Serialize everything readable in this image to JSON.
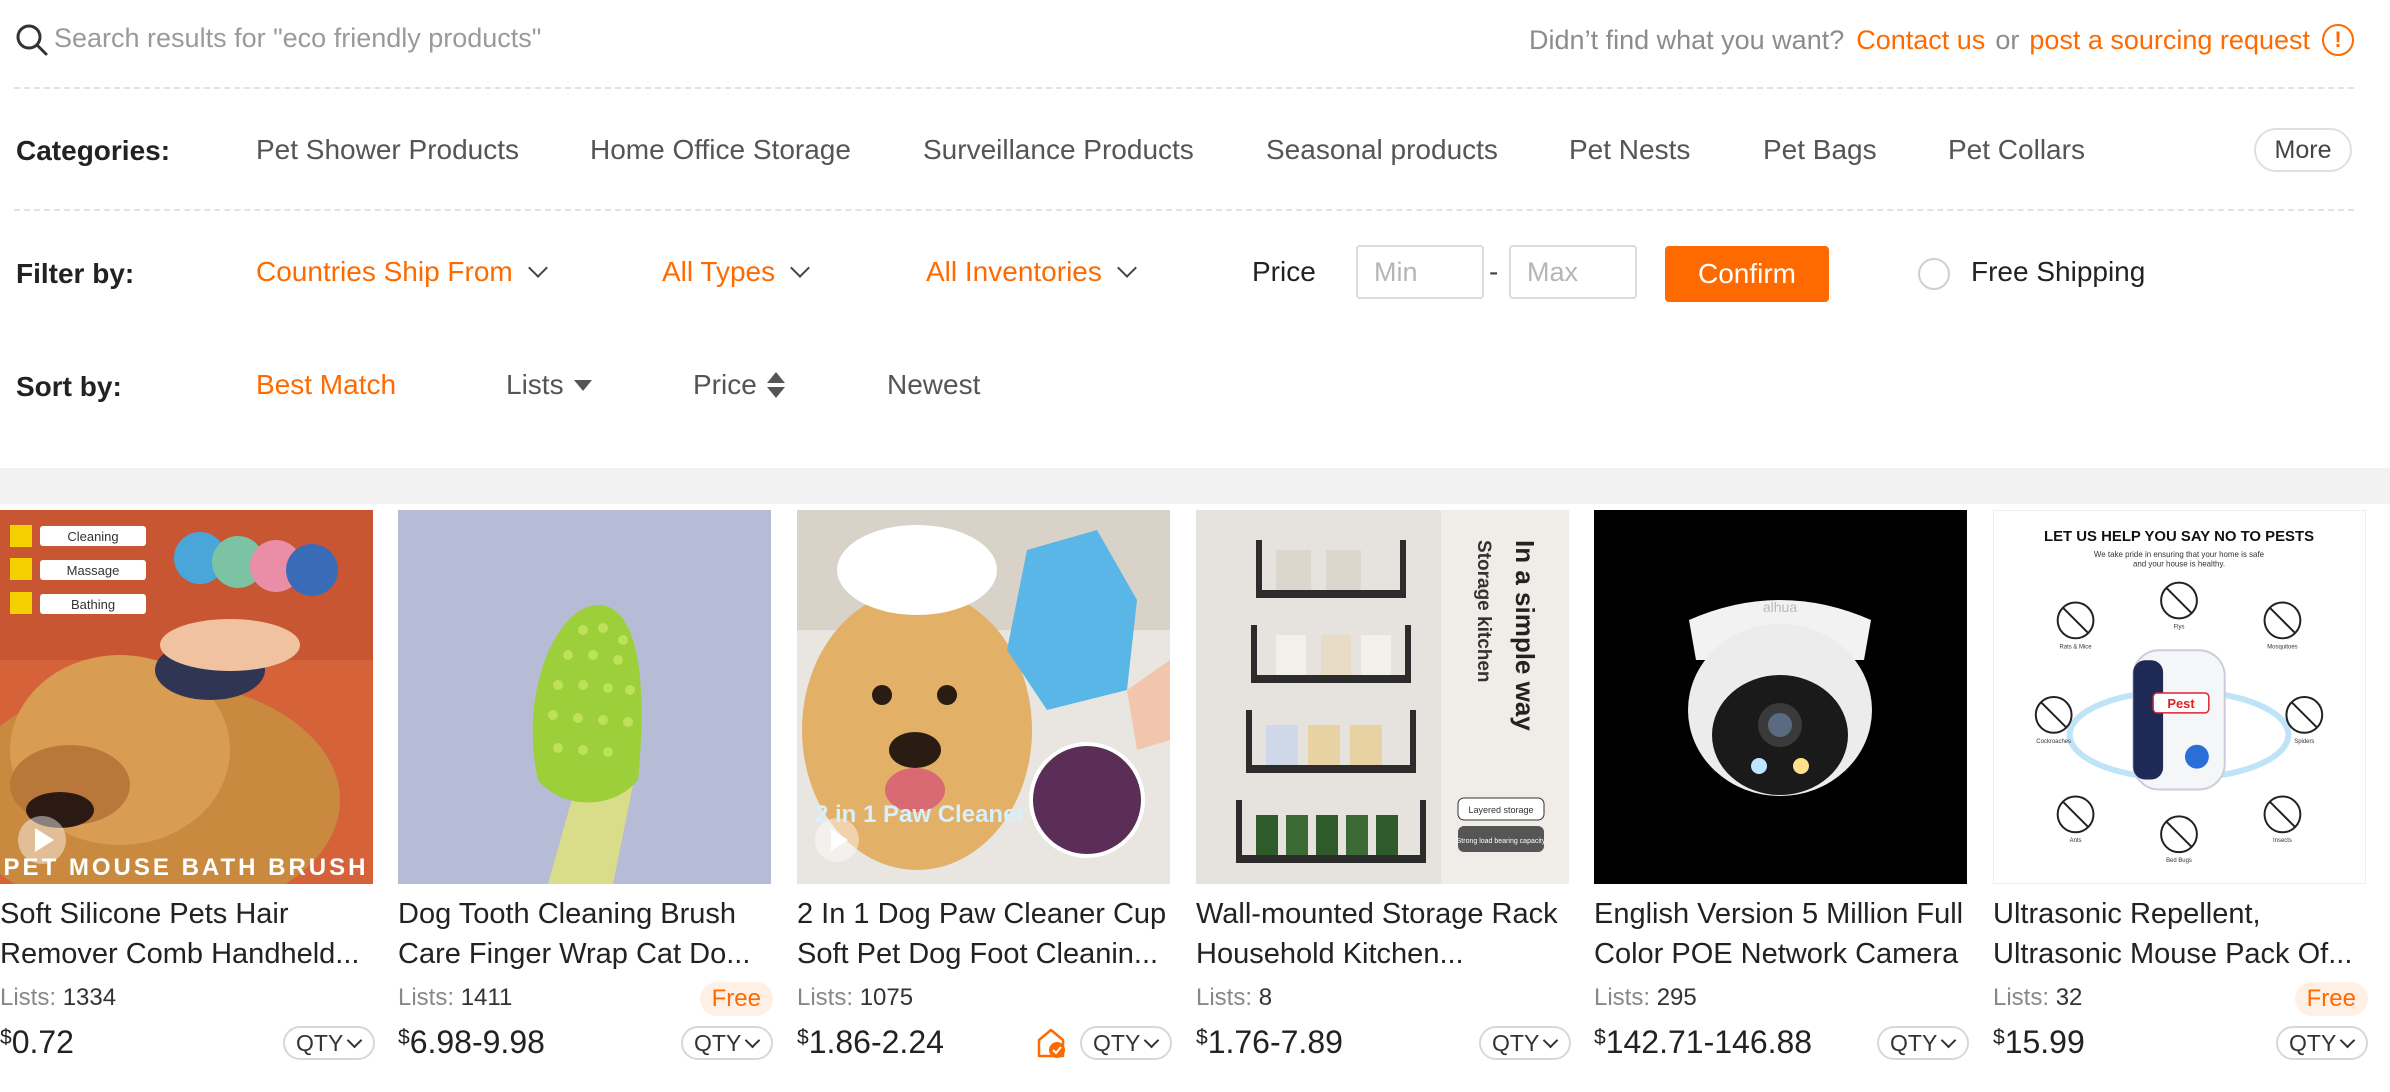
{
  "search": {
    "placeholder": "Search results for \"eco friendly products\""
  },
  "sourcing": {
    "prompt": "Didn’t find what you want?",
    "contact": "Contact us",
    "or": "or",
    "request": "post a sourcing request",
    "info_glyph": "!"
  },
  "categories": {
    "label": "Categories:",
    "items": [
      "Pet Shower Products",
      "Home Office Storage",
      "Surveillance Products",
      "Seasonal products",
      "Pet Nests",
      "Pet Bags",
      "Pet Collars"
    ],
    "more": "More"
  },
  "filters": {
    "label": "Filter by:",
    "dropdowns": [
      "Countries Ship From",
      "All Types",
      "All Inventories"
    ],
    "price_label": "Price",
    "min_placeholder": "Min",
    "dash": "-",
    "max_placeholder": "Max",
    "confirm": "Confirm",
    "free_shipping": "Free Shipping",
    "free_shipping_checked": false
  },
  "sort": {
    "label": "Sort by:",
    "options": [
      "Best Match",
      "Lists",
      "Price",
      "Newest"
    ],
    "active": "Best Match"
  },
  "accent_color": "#ff6a00",
  "currency": "$",
  "products": [
    {
      "title_line1": "Soft Silicone Pets Hair",
      "title_line2": "Remover Comb Handheld...",
      "lists_label": "Lists:",
      "lists": "1334",
      "price": "0.72",
      "qty": "QTY",
      "free": "",
      "image_overlay": "PET MOUSE BATH BRUSH",
      "image_tags": [
        "Cleaning",
        "Massage",
        "Bathing"
      ],
      "has_video": true
    },
    {
      "title_line1": "Dog Tooth Cleaning Brush",
      "title_line2": "Care Finger Wrap Cat Do...",
      "lists_label": "Lists:",
      "lists": "1411",
      "price": "6.98-9.98",
      "qty": "QTY",
      "free": "Free",
      "has_video": false
    },
    {
      "title_line1": "2 In 1 Dog Paw Cleaner Cup",
      "title_line2": "Soft Pet Dog Foot Cleanin...",
      "lists_label": "Lists:",
      "lists": "1075",
      "price": "1.86-2.24",
      "qty": "QTY",
      "free": "",
      "image_overlay": "2 in 1 Paw Cleaner",
      "has_video": true,
      "badge_icon": "shield-check-icon"
    },
    {
      "title_line1": "Wall-mounted Storage Rack",
      "title_line2": "Household Kitchen...",
      "lists_label": "Lists:",
      "lists": "8",
      "price": "1.76-7.89",
      "qty": "QTY",
      "free": "",
      "image_text_a": "In a simple way",
      "image_text_b": "Storage kitchen",
      "image_label_a": "Layered storage",
      "image_label_b": "Strong load bearing capacity"
    },
    {
      "title_line1": "English Version 5 Million Full",
      "title_line2": "Color POE Network Camera",
      "lists_label": "Lists:",
      "lists": "295",
      "price": "142.71-146.88",
      "qty": "QTY",
      "free": "",
      "image_brand": "alhua"
    },
    {
      "title_line1": "Ultrasonic Repellent,",
      "title_line2": "Ultrasonic Mouse Pack Of...",
      "lists_label": "Lists:",
      "lists": "32",
      "price": "15.99",
      "qty": "QTY",
      "free": "Free",
      "image_heading": "LET US HELP YOU SAY NO TO PESTS",
      "image_sub1": "We take pride in ensuring that your home is safe",
      "image_sub2": "and your house is healthy.",
      "image_device_label": "Pest",
      "image_pests": [
        "Rats & Mice",
        "Flys",
        "Mosquitoes",
        "Cockroaches",
        "Spiders",
        "Ants",
        "Bed Bugs",
        "Insects"
      ]
    }
  ]
}
